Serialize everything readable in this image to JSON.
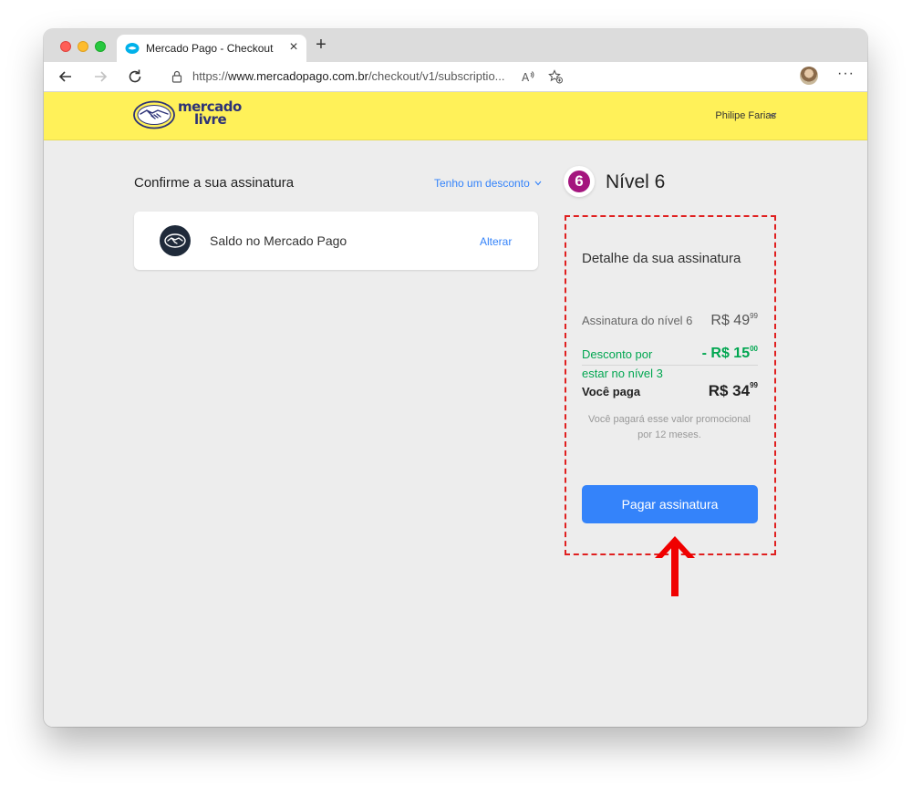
{
  "browser": {
    "tab_title": "Mercado Pago - Checkout",
    "close_tab": "×",
    "new_tab": "+",
    "url_prefix": "https://",
    "url_host": "www.mercadopago.com.br",
    "url_path": "/checkout/v1/subscriptio...",
    "more": "···"
  },
  "header": {
    "logo_line1": "mercado",
    "logo_line2": "livre",
    "user_name": "Philipe Farias"
  },
  "checkout": {
    "title": "Confirme a sua assinatura",
    "discount_link": "Tenho um desconto",
    "payment_method": {
      "label": "Saldo no Mercado Pago",
      "change_link": "Alterar"
    }
  },
  "summary": {
    "level_number": "6",
    "level_title": "Nível 6",
    "detail_title": "Detalhe da sua assinatura",
    "subscription_label": "Assinatura do nível 6",
    "subscription_price": "R$ 49",
    "subscription_cents": "99",
    "discount_label_line1": "Desconto por",
    "discount_label_line2": "estar no nível 3",
    "discount_price": "- R$ 15",
    "discount_cents": "00",
    "total_label": "Você paga",
    "total_price": "R$ 34",
    "total_cents": "99",
    "note": "Você pagará esse valor promocional por 12 meses.",
    "pay_button": "Pagar assinatura"
  },
  "colors": {
    "brand_yellow": "#fff159",
    "primary_blue": "#3483fa",
    "discount_green": "#00a650",
    "level_purple": "#a4157e",
    "annotation_red": "#e02020"
  }
}
